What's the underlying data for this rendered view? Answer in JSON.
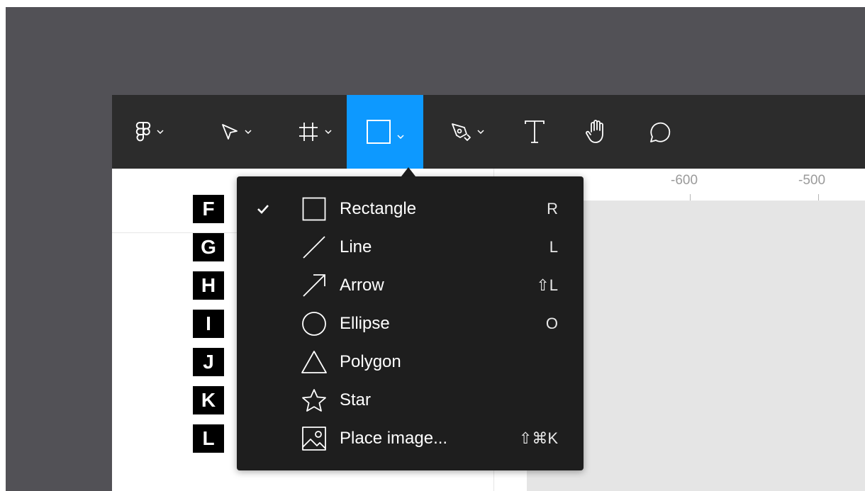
{
  "toolbar": {
    "tools": [
      {
        "name": "figma-menu",
        "icon": "figma-logo-icon"
      },
      {
        "name": "move-tool",
        "icon": "pointer-arrow-icon"
      },
      {
        "name": "frame-tool",
        "icon": "hash-frame-icon"
      },
      {
        "name": "shape-tool",
        "icon": "rectangle-icon",
        "active": true
      },
      {
        "name": "pen-tool",
        "icon": "pen-nib-icon"
      },
      {
        "name": "text-tool",
        "icon": "text-t-icon"
      },
      {
        "name": "hand-tool",
        "icon": "hand-icon"
      },
      {
        "name": "comment-tool",
        "icon": "speech-bubble-icon"
      }
    ],
    "active_color": "#0d99ff",
    "background_color": "#2c2c2c"
  },
  "ruler": {
    "labels": [
      "-600",
      "-500"
    ]
  },
  "callout_letters": [
    "F",
    "G",
    "H",
    "I",
    "J",
    "K",
    "L"
  ],
  "shape_menu": {
    "items": [
      {
        "label": "Rectangle",
        "shortcut": "R",
        "icon": "rectangle-icon",
        "checked": true
      },
      {
        "label": "Line",
        "shortcut": "L",
        "icon": "line-icon",
        "checked": false
      },
      {
        "label": "Arrow",
        "shortcut": "⇧L",
        "icon": "arrow-icon",
        "checked": false
      },
      {
        "label": "Ellipse",
        "shortcut": "O",
        "icon": "ellipse-icon",
        "checked": false
      },
      {
        "label": "Polygon",
        "shortcut": "",
        "icon": "polygon-icon",
        "checked": false
      },
      {
        "label": "Star",
        "shortcut": "",
        "icon": "star-icon",
        "checked": false
      },
      {
        "label": "Place image...",
        "shortcut": "⇧⌘K",
        "icon": "image-icon",
        "checked": false
      }
    ]
  }
}
